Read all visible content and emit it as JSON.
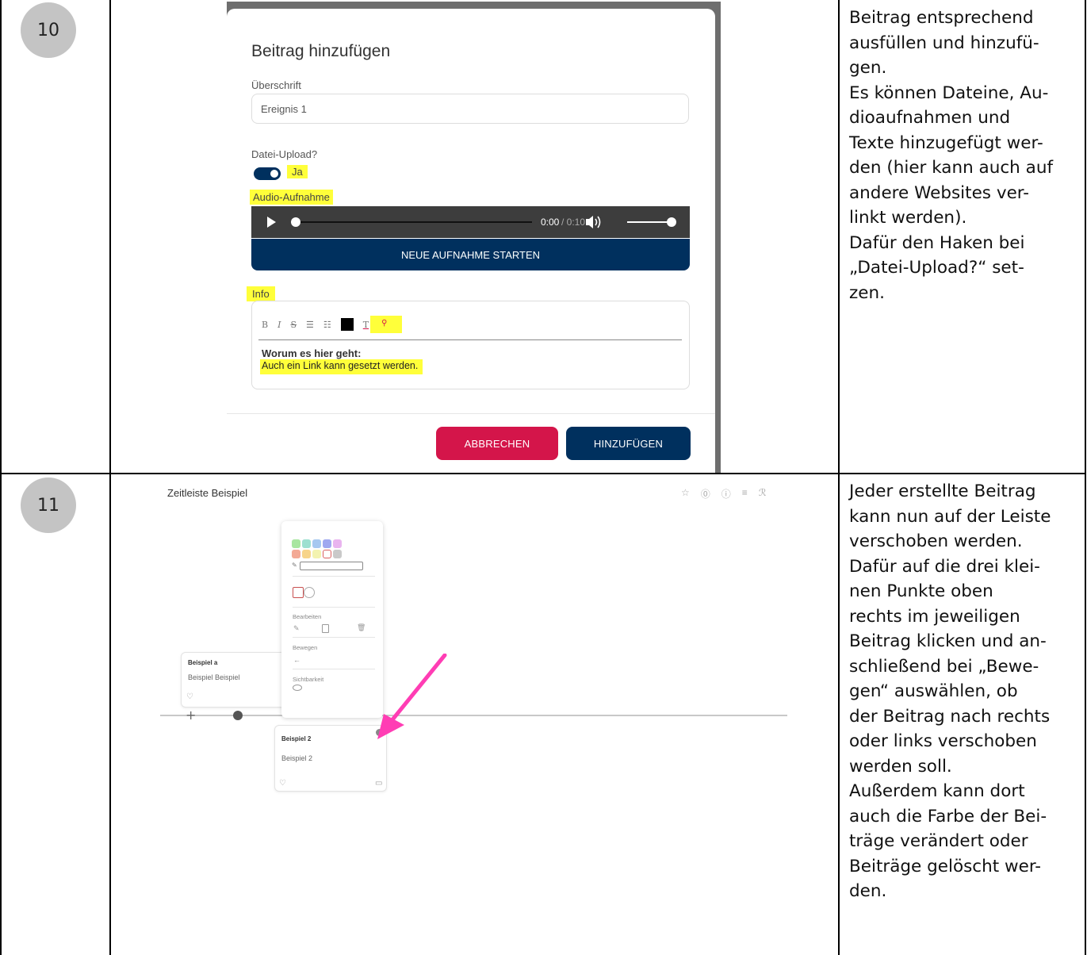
{
  "rows": [
    {
      "number": "10",
      "screenshot": {
        "title": "Beitrag hinzufügen",
        "heading_label": "Überschrift",
        "heading_value": "Ereignis 1",
        "upload_label": "Datei-Upload?",
        "upload_toggle": "Ja",
        "audio_label": "Audio-Aufnahme",
        "audio_time": "0:00",
        "audio_duration": "/ 0:10",
        "new_recording": "NEUE AUFNAHME STARTEN",
        "info_label": "Info",
        "toolbar": [
          "B",
          "I",
          "S",
          "☰",
          "☷",
          "■",
          "T",
          "🔗"
        ],
        "editor_heading": "Worum es hier geht:",
        "editor_text": "Auch ein Link kann gesetzt werden.",
        "cancel": "ABBRECHEN",
        "add": "HINZUFÜGEN",
        "colors": {
          "navy": "#00305e",
          "cancel": "#d4154a",
          "highlight": "#ffff3a"
        }
      },
      "description": [
        "Beitrag entsprechend",
        "ausfüllen und hinzufü-",
        "gen.",
        "Es können Dateine, Au-",
        "dioaufnahmen und",
        "Texte hinzugefügt wer-",
        "den (hier kann auch auf",
        "andere Websites ver-",
        "linkt werden).",
        "Dafür den Haken bei",
        "„Datei-Upload?“ set-",
        "zen."
      ]
    },
    {
      "number": "11",
      "screenshot": {
        "title": "Zeitleiste Beispiel",
        "header_icons": [
          "star-icon",
          "help-icon",
          "info-icon",
          "menu-icon",
          "user-icon"
        ],
        "menu": {
          "edit_label": "Bearbeiten",
          "move_label": "Bewegen",
          "move_arrow": "←",
          "visibility_label": "Sichtbarkeit"
        },
        "card_a": {
          "title": "Beispiel a",
          "text": "Beispiel Beispiel"
        },
        "card_2": {
          "title": "Beispiel 2",
          "text": "Beispiel 2"
        },
        "swatches": [
          "#a8e6a0",
          "#9ee0d0",
          "#a6c8f0",
          "#9fa8f0",
          "#e9b4ef",
          "#f3a995",
          "#f7d48a",
          "#f3f3b0",
          "#ffffff",
          "#c9c9c9"
        ],
        "arrow_color": "#ff3db4"
      },
      "description": [
        "Jeder erstellte Beitrag",
        "kann nun auf der Leiste",
        "verschoben werden.",
        "Dafür auf die drei klei-",
        "nen Punkte oben",
        "rechts im jeweiligen",
        "Beitrag klicken und an-",
        "schließend bei „Bewe-",
        "gen“ auswählen, ob",
        "der Beitrag nach rechts",
        "oder links verschoben",
        "werden soll.",
        "Außerdem kann dort",
        "auch die Farbe der Bei-",
        "träge verändert oder",
        "Beiträge gelöscht wer-",
        "den."
      ]
    }
  ]
}
